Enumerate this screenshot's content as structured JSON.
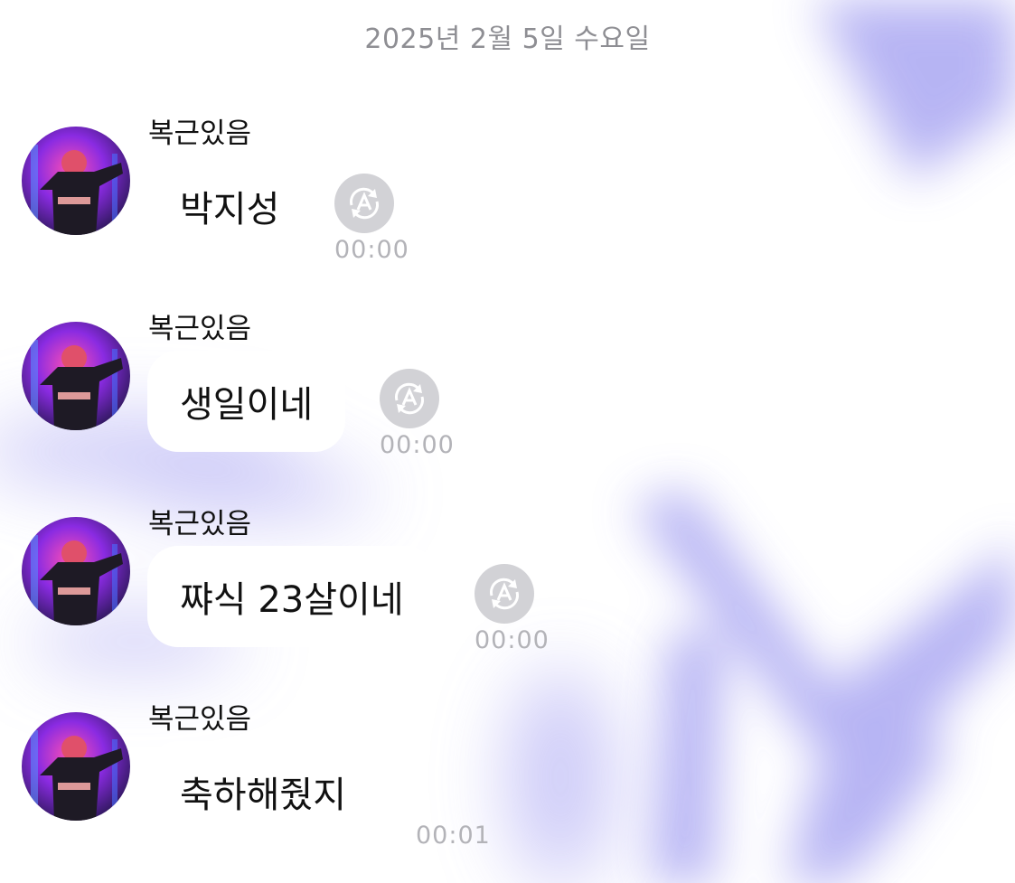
{
  "date_divider": "2025년 2월 5일 수요일",
  "colors": {
    "background": "#ffffff",
    "wallpaper_accent": "#aaa7f2",
    "bubble": "#ffffff",
    "translate_button": "#d2d2d6",
    "timestamp": "#b3b3b8"
  },
  "messages": [
    {
      "sender": "복근있음",
      "text": "박지성",
      "time": "00:00",
      "translate_icon": "auto-translate-icon"
    },
    {
      "sender": "복근있음",
      "text": "생일이네",
      "time": "00:00",
      "translate_icon": "auto-translate-icon"
    },
    {
      "sender": "복근있음",
      "text": "쨔식 23살이네",
      "time": "00:00",
      "translate_icon": "auto-translate-icon"
    },
    {
      "sender": "복근있음",
      "text": "축하해줬지",
      "time": "00:01"
    }
  ]
}
